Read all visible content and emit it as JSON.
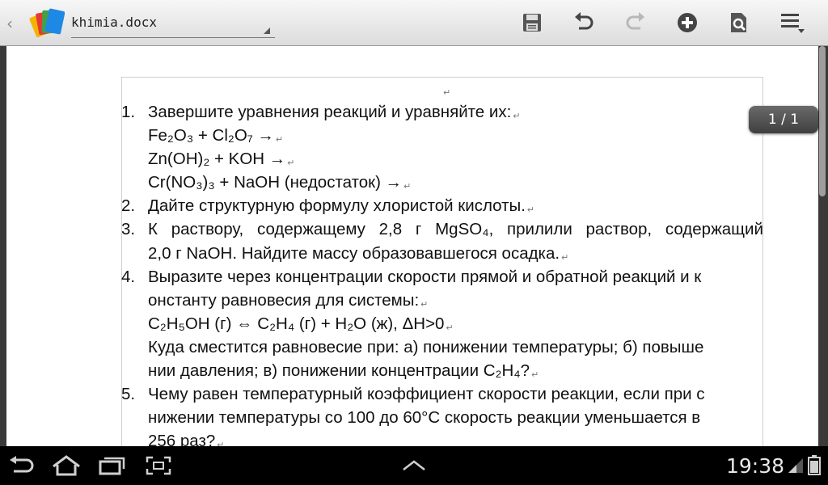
{
  "header": {
    "filename": "khimia.docx"
  },
  "page_indicator": "1 / 1",
  "status_bar": {
    "time": "19:38"
  },
  "document": {
    "paragraph_mark": "↵",
    "q1": {
      "num": "1.",
      "text": "Завершите уравнения реакций и уравняйте их:"
    },
    "eq1": "Fe₂O₃ + Cl₂O₇ →",
    "eq2": "Zn(OH)₂ + KOH →",
    "eq3": "Cr(NO₃)₃ + NaOH (недостаток) →",
    "q2": {
      "num": "2.",
      "text": "Дайте структурную формулу хлористой кислоты."
    },
    "q3": {
      "num": "3.",
      "line1": [
        "К",
        "раствору,",
        "содержащему",
        "2,8",
        "г",
        "MgSO₄,",
        "прилили",
        "раствор,",
        "содержащий"
      ],
      "line2": "2,0 г NaOH. Найдите массу образовавшегося осадка."
    },
    "q4": {
      "num": "4.",
      "line1": "Выразите через концентрации скорости прямой и обратной реакций и к",
      "line2": "онстанту равновесия для системы:",
      "eq": "C₂H₅OH (г) ⇔ C₂H₄ (г) + H₂O (ж), ΔH>0",
      "line3": "Куда сместится равновесие при: а) понижении температуры; б) повыше",
      "line4": "нии давления; в) понижении концентрации C₂H₄?"
    },
    "q5": {
      "num": "5.",
      "line1": "Чему равен температурный коэффициент скорости реакции, если при с",
      "line2": "нижении температуры со 100 до 60°C скорость реакции уменьшается в",
      "line3": "256 раз?"
    }
  }
}
